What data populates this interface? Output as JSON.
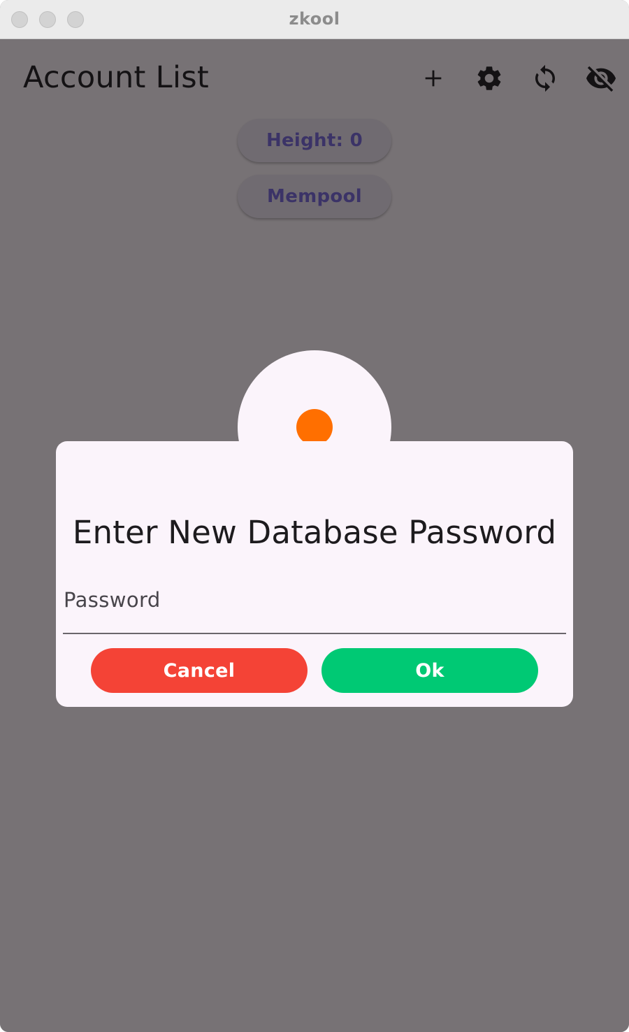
{
  "window": {
    "title": "zkool"
  },
  "appbar": {
    "title": "Account List",
    "icons": [
      "add-icon",
      "settings-icon",
      "sync-icon",
      "visibility-off-icon"
    ]
  },
  "status": {
    "height_label": "Height: 0",
    "mempool_label": "Mempool"
  },
  "dialog": {
    "title": "Enter New Database Password",
    "password_label": "Password",
    "password_value": "",
    "cancel_label": "Cancel",
    "ok_label": "Ok",
    "badge_color": "#ff6f00"
  },
  "colors": {
    "background_scrim": "#777275",
    "dialog_surface": "#fbf4fb",
    "cancel": "#f44336",
    "ok": "#00c974",
    "pill_text": "#3b3367"
  }
}
